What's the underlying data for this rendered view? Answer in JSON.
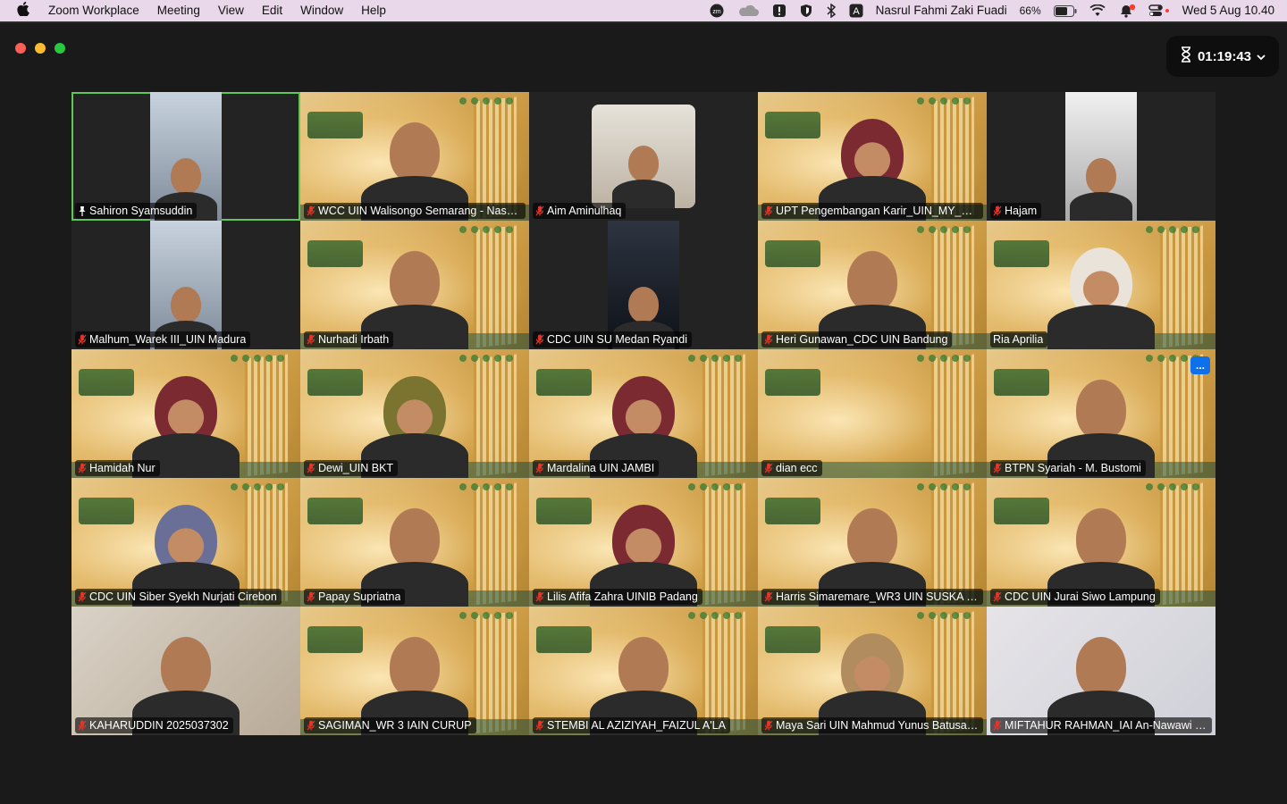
{
  "menubar": {
    "app_name": "Zoom Workplace",
    "menus": [
      "Meeting",
      "View",
      "Edit",
      "Window",
      "Help"
    ],
    "user_name": "Nasrul Fahmi Zaki Fuadi",
    "battery": "66%",
    "datetime": "Wed 5 Aug  10.40",
    "icons": [
      "apple-icon",
      "zoom-icon",
      "cloud-icon",
      "exclamation-icon",
      "shield-icon",
      "bluetooth-icon",
      "input-source-icon",
      "battery-icon",
      "wifi-icon",
      "notification-icon",
      "control-center-icon"
    ]
  },
  "meeting": {
    "timer": "01:19:43"
  },
  "participants": [
    {
      "name": "Sahiron Syamsuddin",
      "style": "dark",
      "active": true,
      "mic": "pinned"
    },
    {
      "name": "WCC UIN Walisongo Semarang - Nasru...",
      "style": "gold",
      "mic": "muted"
    },
    {
      "name": "Aim Aminulhaq",
      "style": "dark",
      "mic": "muted"
    },
    {
      "name": "UPT Pengembangan Karir_UIN_MY_Ba...",
      "style": "gold",
      "mic": "muted"
    },
    {
      "name": "Hajam",
      "style": "dark",
      "mic": "muted"
    },
    {
      "name": "Malhum_Warek III_UIN Madura",
      "style": "dark",
      "mic": "muted"
    },
    {
      "name": "Nurhadi Irbath",
      "style": "gold",
      "mic": "muted"
    },
    {
      "name": "CDC UIN SU Medan Ryandi",
      "style": "dark",
      "mic": "muted"
    },
    {
      "name": "Heri Gunawan_CDC UIN Bandung",
      "style": "gold",
      "mic": "muted"
    },
    {
      "name": "Ria Aprilia",
      "style": "gold",
      "mic": "none"
    },
    {
      "name": "Hamidah Nur",
      "style": "gold",
      "mic": "muted"
    },
    {
      "name": "Dewi_UIN BKT",
      "style": "gold",
      "mic": "muted"
    },
    {
      "name": "Mardalina UIN JAMBI",
      "style": "gold",
      "mic": "muted"
    },
    {
      "name": "dian ecc",
      "style": "gold",
      "mic": "muted"
    },
    {
      "name": "BTPN Syariah - M. Bustomi",
      "style": "gold",
      "mic": "muted",
      "more": true
    },
    {
      "name": "CDC UIN Siber Syekh Nurjati Cirebon",
      "style": "gold",
      "mic": "muted"
    },
    {
      "name": "Papay Supriatna",
      "style": "gold",
      "mic": "muted"
    },
    {
      "name": "Lilis Afifa Zahra UINIB Padang",
      "style": "gold",
      "mic": "muted"
    },
    {
      "name": "Harris Simaremare_WR3 UIN SUSKA Ri...",
      "style": "gold",
      "mic": "muted"
    },
    {
      "name": "CDC UIN Jurai Siwo Lampung",
      "style": "gold",
      "mic": "muted"
    },
    {
      "name": "KAHARUDDIN 2025037302",
      "style": "indoor",
      "mic": "muted"
    },
    {
      "name": "SAGIMAN_WR 3 IAIN CURUP",
      "style": "gold",
      "mic": "muted"
    },
    {
      "name": "STEMBI AL AZIZIYAH_FAIZUL A'LA",
      "style": "gold",
      "mic": "muted"
    },
    {
      "name": "Maya Sari UIN Mahmud Yunus Batusan...",
      "style": "gold",
      "mic": "muted"
    },
    {
      "name": "MIFTAHUR RAHMAN_IAI An-Nawawi P...",
      "style": "light",
      "mic": "muted"
    }
  ],
  "more_label": "...",
  "colors": {
    "active_border": "#5dc75a",
    "muted_mic": "#e0352b",
    "more_button": "#0e71eb"
  }
}
